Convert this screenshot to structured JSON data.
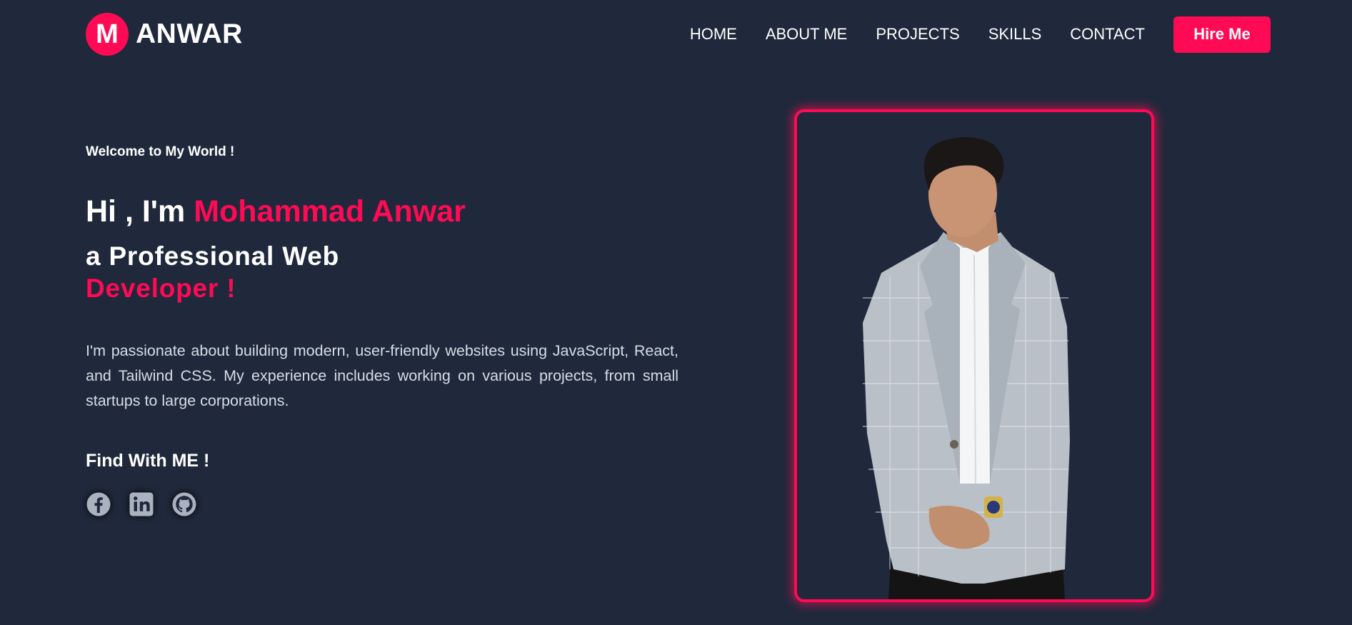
{
  "brand": {
    "initial": "M",
    "name": "ANWAR"
  },
  "nav": {
    "items": [
      {
        "label": "HOME"
      },
      {
        "label": "ABOUT ME"
      },
      {
        "label": "PROJECTS"
      },
      {
        "label": "SKILLS"
      },
      {
        "label": "CONTACT"
      }
    ],
    "cta_label": "Hire Me"
  },
  "hero": {
    "welcome": "Welcome to My World !",
    "greeting": "Hi , I'm ",
    "name": "Mohammad Anwar",
    "role_line1": "a Professional Web",
    "role_line2": "Developer !",
    "description": "I'm passionate about building modern, user-friendly websites using JavaScript, React, and Tailwind CSS. My experience includes working on various projects, from small startups to large corporations.",
    "find_title": "Find With ME !",
    "socials": [
      {
        "icon": "facebook-icon"
      },
      {
        "icon": "linkedin-icon"
      },
      {
        "icon": "github-icon"
      }
    ]
  },
  "colors": {
    "background": "#1f293b",
    "accent": "#ff0a54",
    "text": "#ffffff",
    "muted": "#d7dce4"
  }
}
